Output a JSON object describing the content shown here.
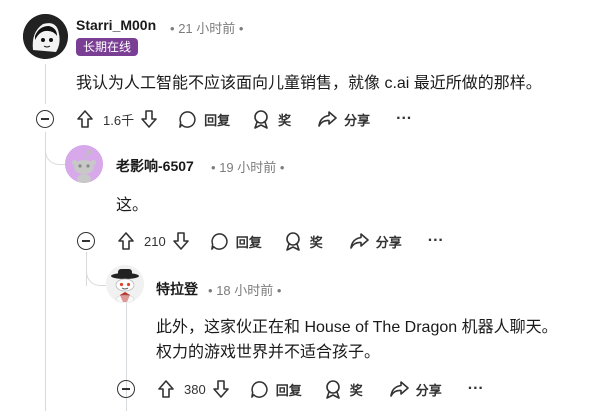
{
  "comments": [
    {
      "username": "Starri_M00n",
      "time": "21 小时前",
      "flair": "长期在线",
      "body": "我认为人工智能不应该面向儿童销售，就像 c.ai 最近所做的那样。",
      "votes": "1.6千"
    },
    {
      "username": "老影响-6507",
      "time": "19 小时前",
      "body": "这。",
      "votes": "210"
    },
    {
      "username": "特拉登",
      "time": "18 小时前",
      "body_line1": "此外，这家伙正在和 House of The Dragon 机器人聊天。",
      "body_line2": "权力的游戏世界并不适合孩子。",
      "votes": "380"
    }
  ],
  "actions": {
    "reply": "回复",
    "award": "奖",
    "share": "分享",
    "more": "···",
    "dot": "•"
  },
  "colors": {
    "flair_bg": "#7a3f95",
    "thread_line": "#d7dadc",
    "meta_text": "#7c7c7c"
  }
}
